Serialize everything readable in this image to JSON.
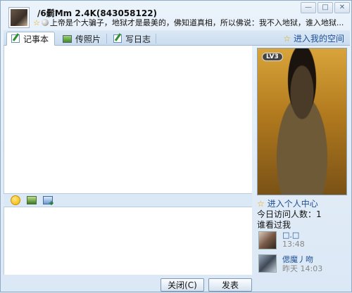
{
  "header": {
    "nickname": "/6鬎Mm 2.4K(843058122)",
    "signature": "上帝是个大骗子，地狱才是最美的，佛知道真相，所以佛说：我不入地狱，谁入地狱..."
  },
  "window_buttons": [
    "—",
    "□",
    "✕"
  ],
  "tabs": [
    {
      "label": "记事本",
      "active": true
    },
    {
      "label": "传照片",
      "active": false
    },
    {
      "label": "写日志",
      "active": false
    }
  ],
  "space_link": "进入我的空间",
  "profile": {
    "level_badge": "LV3",
    "center_link": "进入个人中心",
    "visits": "今日访问人数：1",
    "who_viewed": "谁看过我"
  },
  "visitors": [
    {
      "name": "□.□",
      "time": "13:48"
    },
    {
      "name": "偲魔丿吻",
      "time": "昨天 14:03"
    }
  ],
  "footer": {
    "close_label": "关闭(C)",
    "send_label": "发表"
  }
}
